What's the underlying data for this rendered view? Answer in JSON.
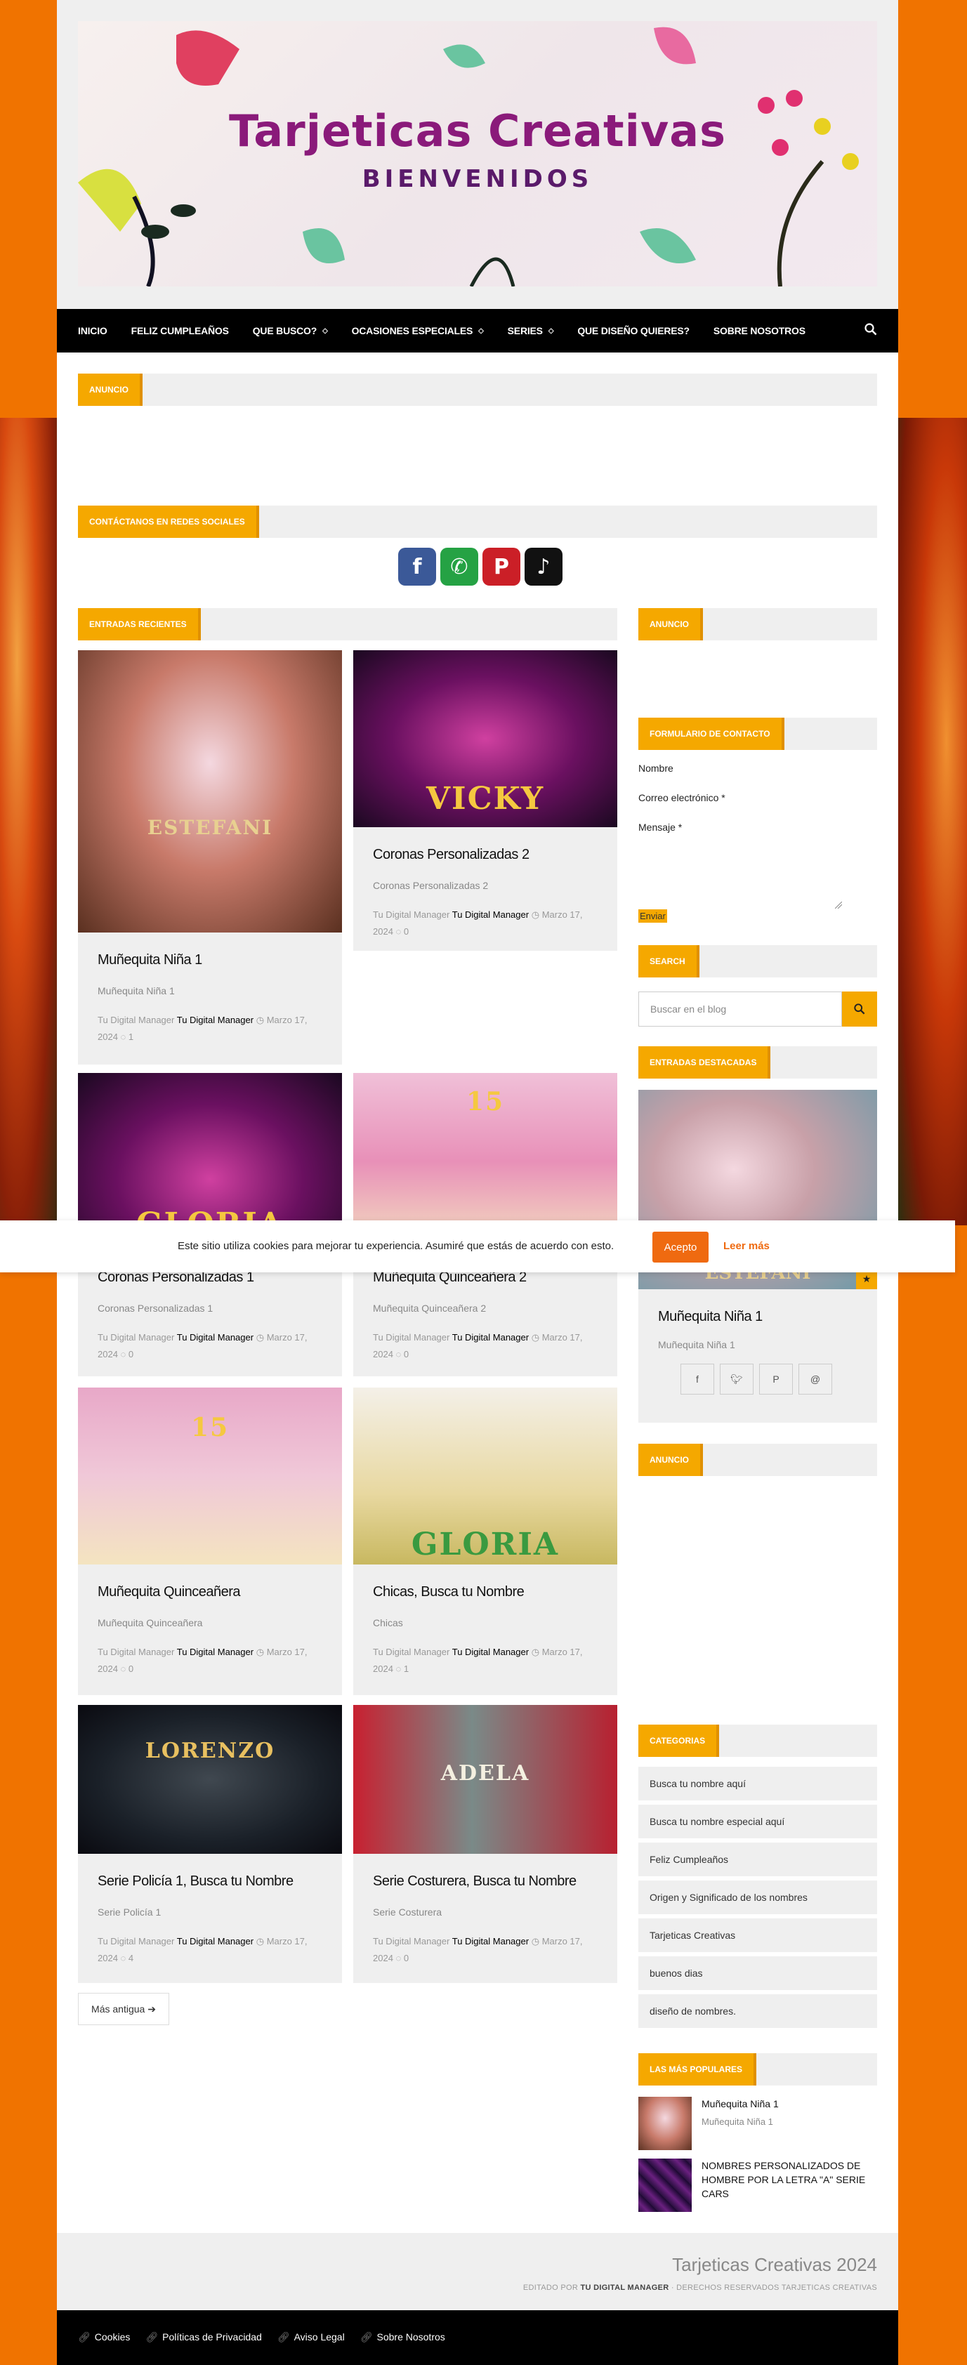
{
  "banner": {
    "title": "Tarjeticas Creativas",
    "subtitle": "BIENVENIDOS"
  },
  "nav": {
    "items": [
      {
        "label": "INICIO"
      },
      {
        "label": "FELIZ CUMPLEAÑOS"
      },
      {
        "label": "QUE BUSCO?"
      },
      {
        "label": "OCASIONES ESPECIALES"
      },
      {
        "label": "SERIES"
      },
      {
        "label": "QUE DISEÑO QUIERES?"
      },
      {
        "label": "SOBRE NOSOTROS"
      }
    ],
    "search_icon": "search-icon"
  },
  "sections": {
    "anuncio_top": "ANUNCIO",
    "social": "CONTÁCTANOS EN REDES SOCIALES",
    "recent": "ENTRADAS RECIENTES",
    "anuncio_side": "ANUNCIO",
    "contact": "FORMULARIO DE CONTACTO",
    "search": "SEARCH",
    "featured": "ENTRADAS DESTACADAS",
    "anuncio_side2": "ANUNCIO",
    "categories": "CATEGORIAS",
    "popular": "LAS MÁS POPULARES"
  },
  "social_icons": [
    {
      "name": "facebook-icon",
      "glyph": "f",
      "color": "#3b5998"
    },
    {
      "name": "whatsapp-icon",
      "glyph": "✆",
      "color": "#25a244"
    },
    {
      "name": "pinterest-icon",
      "glyph": "P",
      "color": "#cb1f27"
    },
    {
      "name": "tiktok-icon",
      "glyph": "♪",
      "color": "#111111"
    }
  ],
  "posts": [
    {
      "title": "Muñequita Niña 1",
      "excerpt": "Muñequita Niña 1",
      "author": "Tu Digital Manager",
      "date": "Marzo 17, 2024",
      "comments": "1",
      "thumb_label": "ESTEFANI"
    },
    {
      "title": "Coronas Personalizadas 2",
      "excerpt": "Coronas Personalizadas 2",
      "author": "Tu Digital Manager",
      "date": "Marzo 17, 2024",
      "comments": "0",
      "thumb_label": "VICKY"
    },
    {
      "title": "Coronas Personalizadas 1",
      "excerpt": "Coronas Personalizadas 1",
      "author": "Tu Digital Manager",
      "date": "Marzo 17, 2024",
      "comments": "0",
      "thumb_label": "GLORIA"
    },
    {
      "title": "Muñequita Quinceañera 2",
      "excerpt": "Muñequita Quinceañera 2",
      "author": "Tu Digital Manager",
      "date": "Marzo 17, 2024",
      "comments": "0",
      "thumb_label": "15"
    },
    {
      "title": "Muñequita Quinceañera",
      "excerpt": "Muñequita Quinceañera",
      "author": "Tu Digital Manager",
      "date": "Marzo 17, 2024",
      "comments": "0",
      "thumb_label": "15"
    },
    {
      "title": "Chicas, Busca tu Nombre",
      "excerpt": "Chicas",
      "author": "Tu Digital Manager",
      "date": "Marzo 17, 2024",
      "comments": "1",
      "thumb_label": "GLORIA"
    },
    {
      "title": "Serie Policía 1, Busca tu Nombre",
      "excerpt": "Serie Policía 1",
      "author": "Tu Digital Manager",
      "date": "Marzo 17, 2024",
      "comments": "4",
      "thumb_label": "LORENZO"
    },
    {
      "title": "Serie Costurera, Busca tu Nombre",
      "excerpt": "Serie Costurera",
      "author": "Tu Digital Manager",
      "date": "Marzo 17, 2024",
      "comments": "0",
      "thumb_label": "ADELA"
    }
  ],
  "post_author_prefix": "Tu Digital Manager",
  "older_button": "Más antigua",
  "contact_form": {
    "name_label": "Nombre",
    "email_label": "Correo electrónico *",
    "message_label": "Mensaje *",
    "submit": "Enviar"
  },
  "search": {
    "placeholder": "Buscar en el blog"
  },
  "featured": {
    "title": "Muñequita Niña 1",
    "excerpt": "Muñequita Niña 1",
    "thumb_label": "ESTEFANI"
  },
  "share_icons": [
    "facebook-icon",
    "twitter-icon",
    "pinterest-icon",
    "email-icon"
  ],
  "categories": [
    "Busca tu nombre aquí",
    "Busca tu nombre especial aquí",
    "Feliz Cumpleaños",
    "Origen y Significado de los nombres",
    "Tarjeticas Creativas",
    "buenos dias",
    "diseño de nombres."
  ],
  "popular": [
    {
      "title": "Muñequita Niña 1",
      "excerpt": "Muñequita Niña 1"
    },
    {
      "title": "NOMBRES PERSONALIZADOS DE HOMBRE POR LA LETRA \"A\" SERIE CARS",
      "excerpt": ""
    }
  ],
  "footer": {
    "brand": "Tarjeticas Creativas 2024",
    "credit_prefix": "EDITADO POR",
    "credit_name": "TU DIGITAL MANAGER",
    "credit_suffix": "· DERECHOS RESERVADOS TARJETICAS CREATIVAS",
    "links": [
      "Cookies",
      "Políticas de Privacidad",
      "Aviso Legal",
      "Sobre Nosotros"
    ]
  },
  "cookie": {
    "message": "Este sitio utiliza cookies para mejorar tu experiencia. Asumiré que estás de acuerdo con esto.",
    "accept": "Acepto",
    "more": "Leer más"
  },
  "colors": {
    "accent": "#f5a800",
    "page_bg": "#f07300",
    "nav_bg": "#000000",
    "cookie_accent": "#ef6a10"
  }
}
